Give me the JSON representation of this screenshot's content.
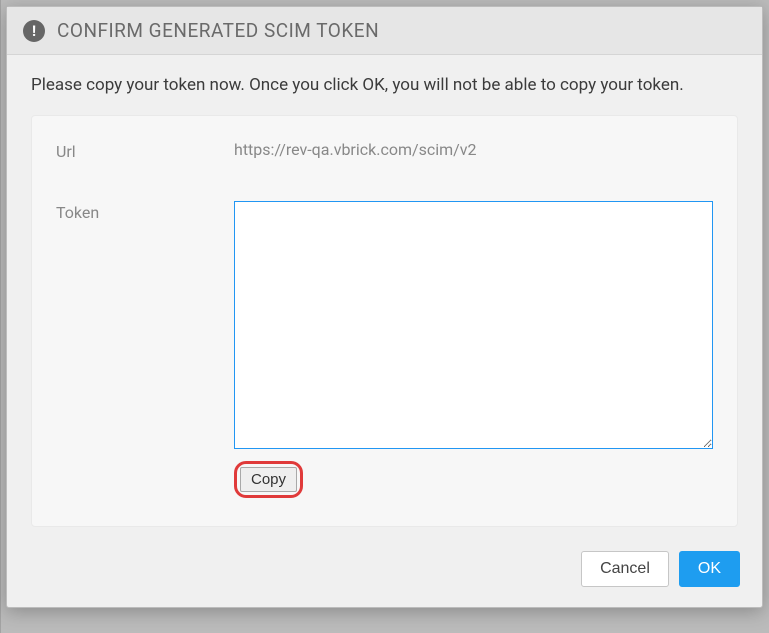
{
  "dialog": {
    "title": "CONFIRM GENERATED SCIM TOKEN",
    "instruction": "Please copy your token now. Once you click OK, you will not be able to copy your token.",
    "fields": {
      "url_label": "Url",
      "url_value": "https://rev-qa.vbrick.com/scim/v2",
      "token_label": "Token",
      "token_value": ""
    },
    "buttons": {
      "copy": "Copy",
      "cancel": "Cancel",
      "ok": "OK"
    }
  }
}
